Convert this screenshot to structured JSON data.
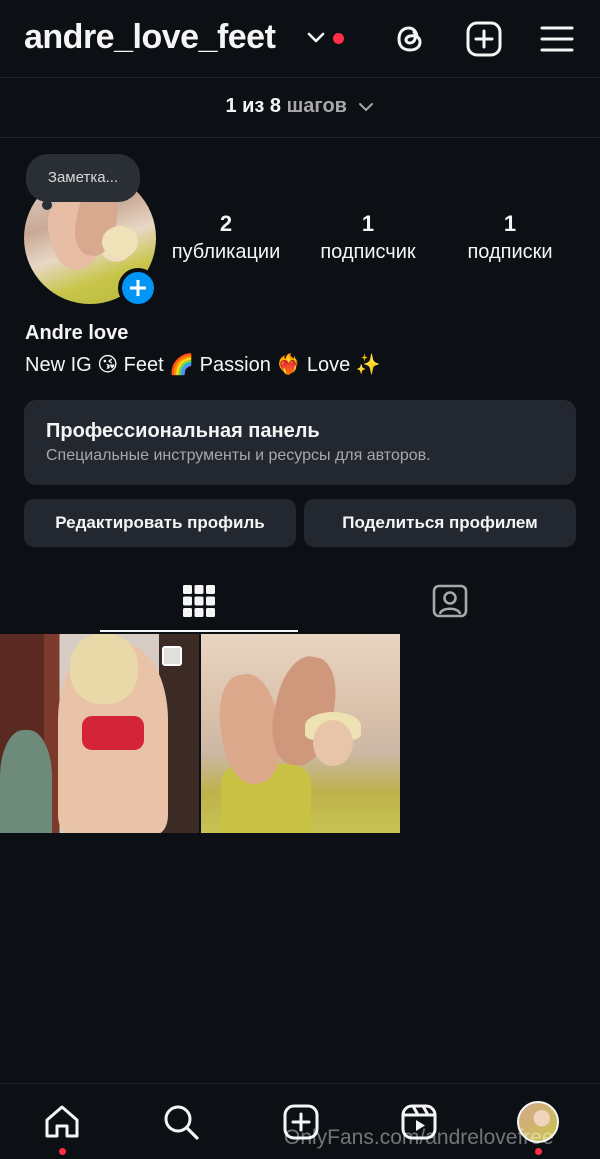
{
  "header": {
    "username": "andre_love_feet",
    "has_notification": true,
    "icons": [
      "threads-icon",
      "create-post-icon",
      "menu-icon"
    ]
  },
  "steps": {
    "current": "1 из 8",
    "label": "шагов"
  },
  "profile": {
    "note_placeholder": "Заметка...",
    "stats": [
      {
        "count": "2",
        "label": "публикации"
      },
      {
        "count": "1",
        "label": "подписчик"
      },
      {
        "count": "1",
        "label": "подписки"
      }
    ],
    "full_name": "Andre love",
    "bio": "New IG 😘 Feet 🌈 Passion ❤️‍🔥 Love ✨"
  },
  "professional_panel": {
    "title": "Профессиональная панель",
    "subtitle": "Специальные инструменты и ресурсы для авторов."
  },
  "actions": {
    "edit_profile": "Редактировать профиль",
    "share_profile": "Поделиться профилем"
  },
  "tabs": {
    "active": "posts-grid",
    "items": [
      "grid-icon",
      "tagged-icon"
    ]
  },
  "posts": {
    "count": 2,
    "first_is_carousel": true
  },
  "bottom_nav": {
    "items": [
      "home-icon",
      "search-icon",
      "create-icon",
      "reels-icon",
      "profile-avatar"
    ],
    "dots_on": [
      "home-icon",
      "profile-avatar"
    ]
  },
  "watermark": "OnlyFans.com/andrelovefree",
  "colors": {
    "background": "#0c0f14",
    "surface": "#232730",
    "accent_blue": "#0095f6",
    "notification_red": "#ff2d45",
    "secondary_text": "#a8a8a8"
  }
}
